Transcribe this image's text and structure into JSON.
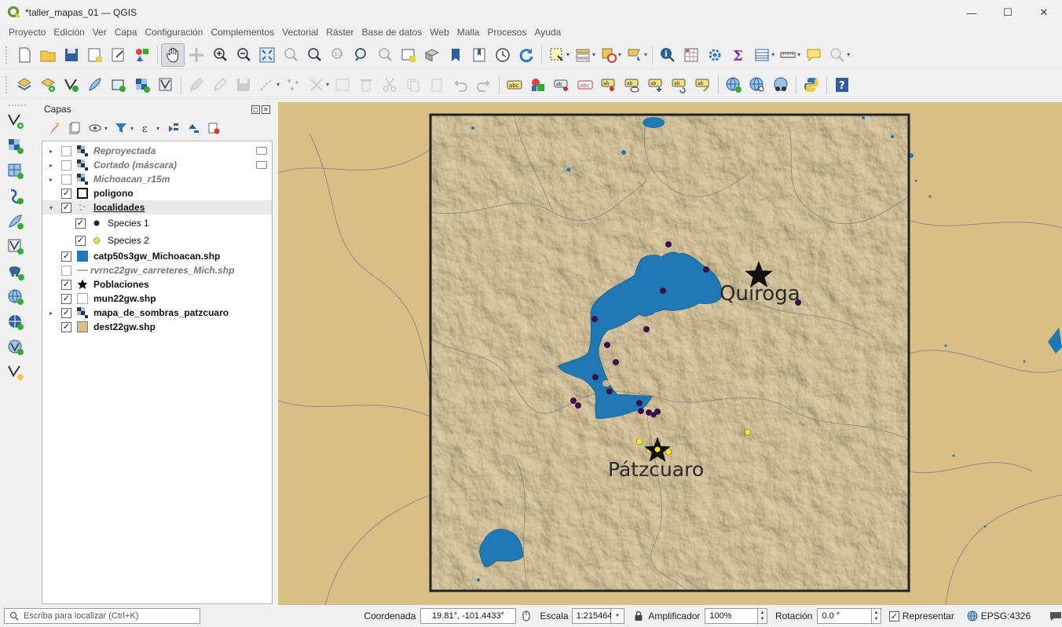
{
  "window": {
    "title": "*taller_mapas_01 — QGIS",
    "minimize": "—",
    "maximize": "☐",
    "close": "✕"
  },
  "menu": [
    "Proyecto",
    "Edición",
    "Ver",
    "Capa",
    "Configuración",
    "Complementos",
    "Vectorial",
    "Ráster",
    "Base de datos",
    "Web",
    "Malla",
    "Procesos",
    "Ayuda"
  ],
  "layers_panel": {
    "title": "Capas",
    "float_btn": "◻",
    "close_btn": "✕"
  },
  "layers": [
    {
      "name": "Reproyectada",
      "checked": false,
      "expander": "▸",
      "symbol": "raster-icon",
      "style": "italic"
    },
    {
      "name": "Cortado (máscara)",
      "checked": false,
      "expander": "▸",
      "symbol": "raster-icon",
      "style": "italic"
    },
    {
      "name": "Michoacan_r15m",
      "checked": false,
      "expander": "▸",
      "symbol": "raster-icon",
      "style": "italic"
    },
    {
      "name": "poligono",
      "checked": true,
      "expander": "",
      "symbol": "outline-polygon-symbol",
      "style": "bold"
    },
    {
      "name": "localidades",
      "checked": true,
      "expander": "▾",
      "symbol": "points-icon",
      "style": "bold-under"
    },
    {
      "name": "Species 1",
      "checked": true,
      "expander": "",
      "symbol": "purple-point-symbol",
      "style": "normal",
      "indent": true
    },
    {
      "name": "Species 2",
      "checked": true,
      "expander": "",
      "symbol": "yellow-point-symbol",
      "style": "normal",
      "indent": true
    },
    {
      "name": "catp50s3gw_Michoacan.shp",
      "checked": true,
      "expander": "",
      "symbol": "blue-fill-symbol",
      "style": "bold"
    },
    {
      "name": "rvrnc22gw_carreteres_Mich.shp",
      "checked": false,
      "expander": "",
      "symbol": "line-symbol",
      "style": "italic"
    },
    {
      "name": "Poblaciones",
      "checked": true,
      "expander": "",
      "symbol": "star-symbol",
      "style": "bold"
    },
    {
      "name": "mun22gw.shp",
      "checked": true,
      "expander": "",
      "symbol": "white-fill-symbol",
      "style": "bold"
    },
    {
      "name": "mapa_de_sombras_patzcuaro",
      "checked": true,
      "expander": "▸",
      "symbol": "raster-icon",
      "style": "bold"
    },
    {
      "name": "dest22gw.shp",
      "checked": true,
      "expander": "",
      "symbol": "tan-fill-symbol",
      "style": "bold"
    }
  ],
  "map": {
    "labels": {
      "quiroga": "Quiroga",
      "patzcuaro": "Pátzcuaro"
    },
    "colors": {
      "background": "#d8bf85",
      "hillshade": "#c9b58c",
      "lake": "#1f77b4",
      "species1": "#3d0f4a",
      "species2": "#ffe81a",
      "frame": "#222222"
    }
  },
  "status": {
    "locator_placeholder": "Escriba para localizar (Ctrl+K)",
    "coord_label": "Coordenada",
    "coord_value": "19.81°, -101.4433°",
    "scale_label": "Escala",
    "scale_value": "1:215464",
    "magnifier_label": "Amplificador",
    "magnifier_value": "100%",
    "rotation_label": "Rotación",
    "rotation_value": "0.0 °",
    "render_label": "Representar",
    "crs": "EPSG:4326"
  }
}
